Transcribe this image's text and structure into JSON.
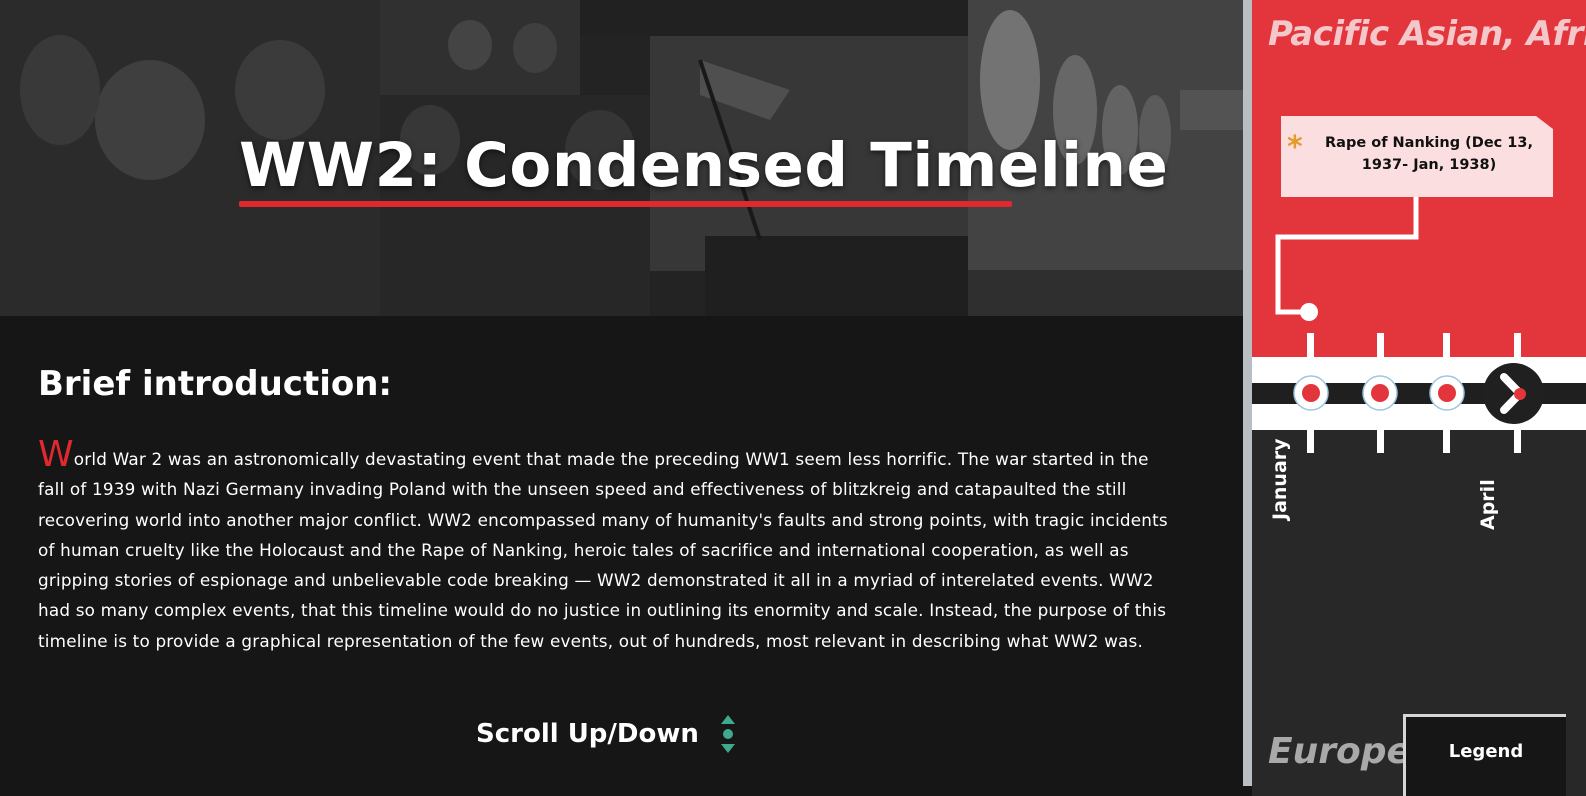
{
  "hero": {
    "title": "WW2: Condensed Timeline"
  },
  "intro": {
    "heading": "Brief introduction:",
    "drop_cap": "W",
    "body": "orld War 2 was an astronomically devastating event that made the preceding WW1 seem less horrific. The war started in the fall of 1939 with Nazi Germany invading Poland with the unseen speed and effectiveness of blitzkreig and catapaulted the still recovering world into another major conflict. WW2 encompassed many of humanity's faults and strong points, with tragic incidents of human cruelty like the Holocaust and the Rape of Nanking, heroic tales of sacrifice and international cooperation, as well as gripping stories of espionage and unbelievable code breaking — WW2 demonstrated it all in a myriad of interelated events. WW2 had so many complex events, that this timeline would do no justice in outlining its enormity and scale. Instead, the purpose of this timeline is to provide a graphical representation of the few events, out of hundreds, most relevant in describing what WW2 was."
  },
  "scroll_hint": {
    "label": "Scroll Up/Down",
    "icon": "scroll-up-down-icon"
  },
  "timeline": {
    "region_top": "Pacific Asian, Africa",
    "region_bottom": "Europe",
    "event": {
      "icon": "star-icon",
      "text": "Rape of Nanking (Dec 13, 1937- Jan, 1938)"
    },
    "months": [
      "January",
      "April"
    ],
    "next_icon": "chevron-right-icon",
    "legend_label": "Legend"
  },
  "colors": {
    "accent_red": "#e0292f",
    "timeline_red": "#e3353c",
    "event_card": "#fbdfe0",
    "star": "#e49b2d",
    "scroll_icon": "#3ea98c",
    "background": "#161617"
  }
}
